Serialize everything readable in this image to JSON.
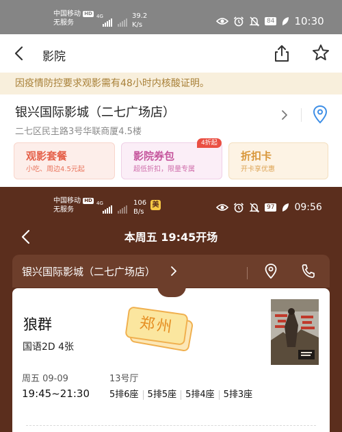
{
  "top_screenshot": {
    "status_bar": {
      "carrier": "中国移动",
      "hd": "HD",
      "service": "无服务",
      "network": "4G",
      "speed_value": "39.2",
      "speed_unit": "K/s",
      "battery": "84",
      "time": "10:30"
    },
    "nav": {
      "title": "影院"
    },
    "notice": "因疫情防控要求观影需有48小时内核酸证明。",
    "cinema": {
      "name": "银兴国际影城（二七广场店）",
      "address": "二七区民主路3号华联商厦4.5楼"
    },
    "cards": [
      {
        "title": "观影套餐",
        "subtitle": "小吃、周边4.5元起"
      },
      {
        "title": "影院券包",
        "subtitle": "超低折扣，限量专属",
        "badge": "4折起"
      },
      {
        "title": "折扣卡",
        "subtitle": "开卡享优惠"
      }
    ]
  },
  "bottom_screenshot": {
    "status_bar": {
      "carrier": "中国移动",
      "hd": "HD",
      "service": "无服务",
      "network": "4G",
      "speed_value": "106",
      "speed_unit": "B/s",
      "app_badge": "美",
      "battery": "97",
      "time": "09:56"
    },
    "header_title": "本周五 19:45开场",
    "cinema_name": "银兴国际影城（二七广场店）",
    "ticket": {
      "movie": "狼群",
      "info": "国语2D 4张",
      "city_tag": "郑州",
      "date": "周五 09-09",
      "time_range": "19:45~21:30",
      "hall": "13号厅",
      "seats": [
        "5排6座",
        "5排5座",
        "5排4座",
        "5排3座"
      ]
    }
  },
  "colors": {
    "notice_bg": "#f8efdc",
    "notice_text": "#a88038",
    "brown_bg": "#5b2e1d",
    "pin_blue": "#3d8ee6"
  },
  "icons": [
    "back-icon",
    "share-icon",
    "star-icon",
    "location-pin-icon",
    "phone-icon",
    "chevron-right-icon"
  ]
}
